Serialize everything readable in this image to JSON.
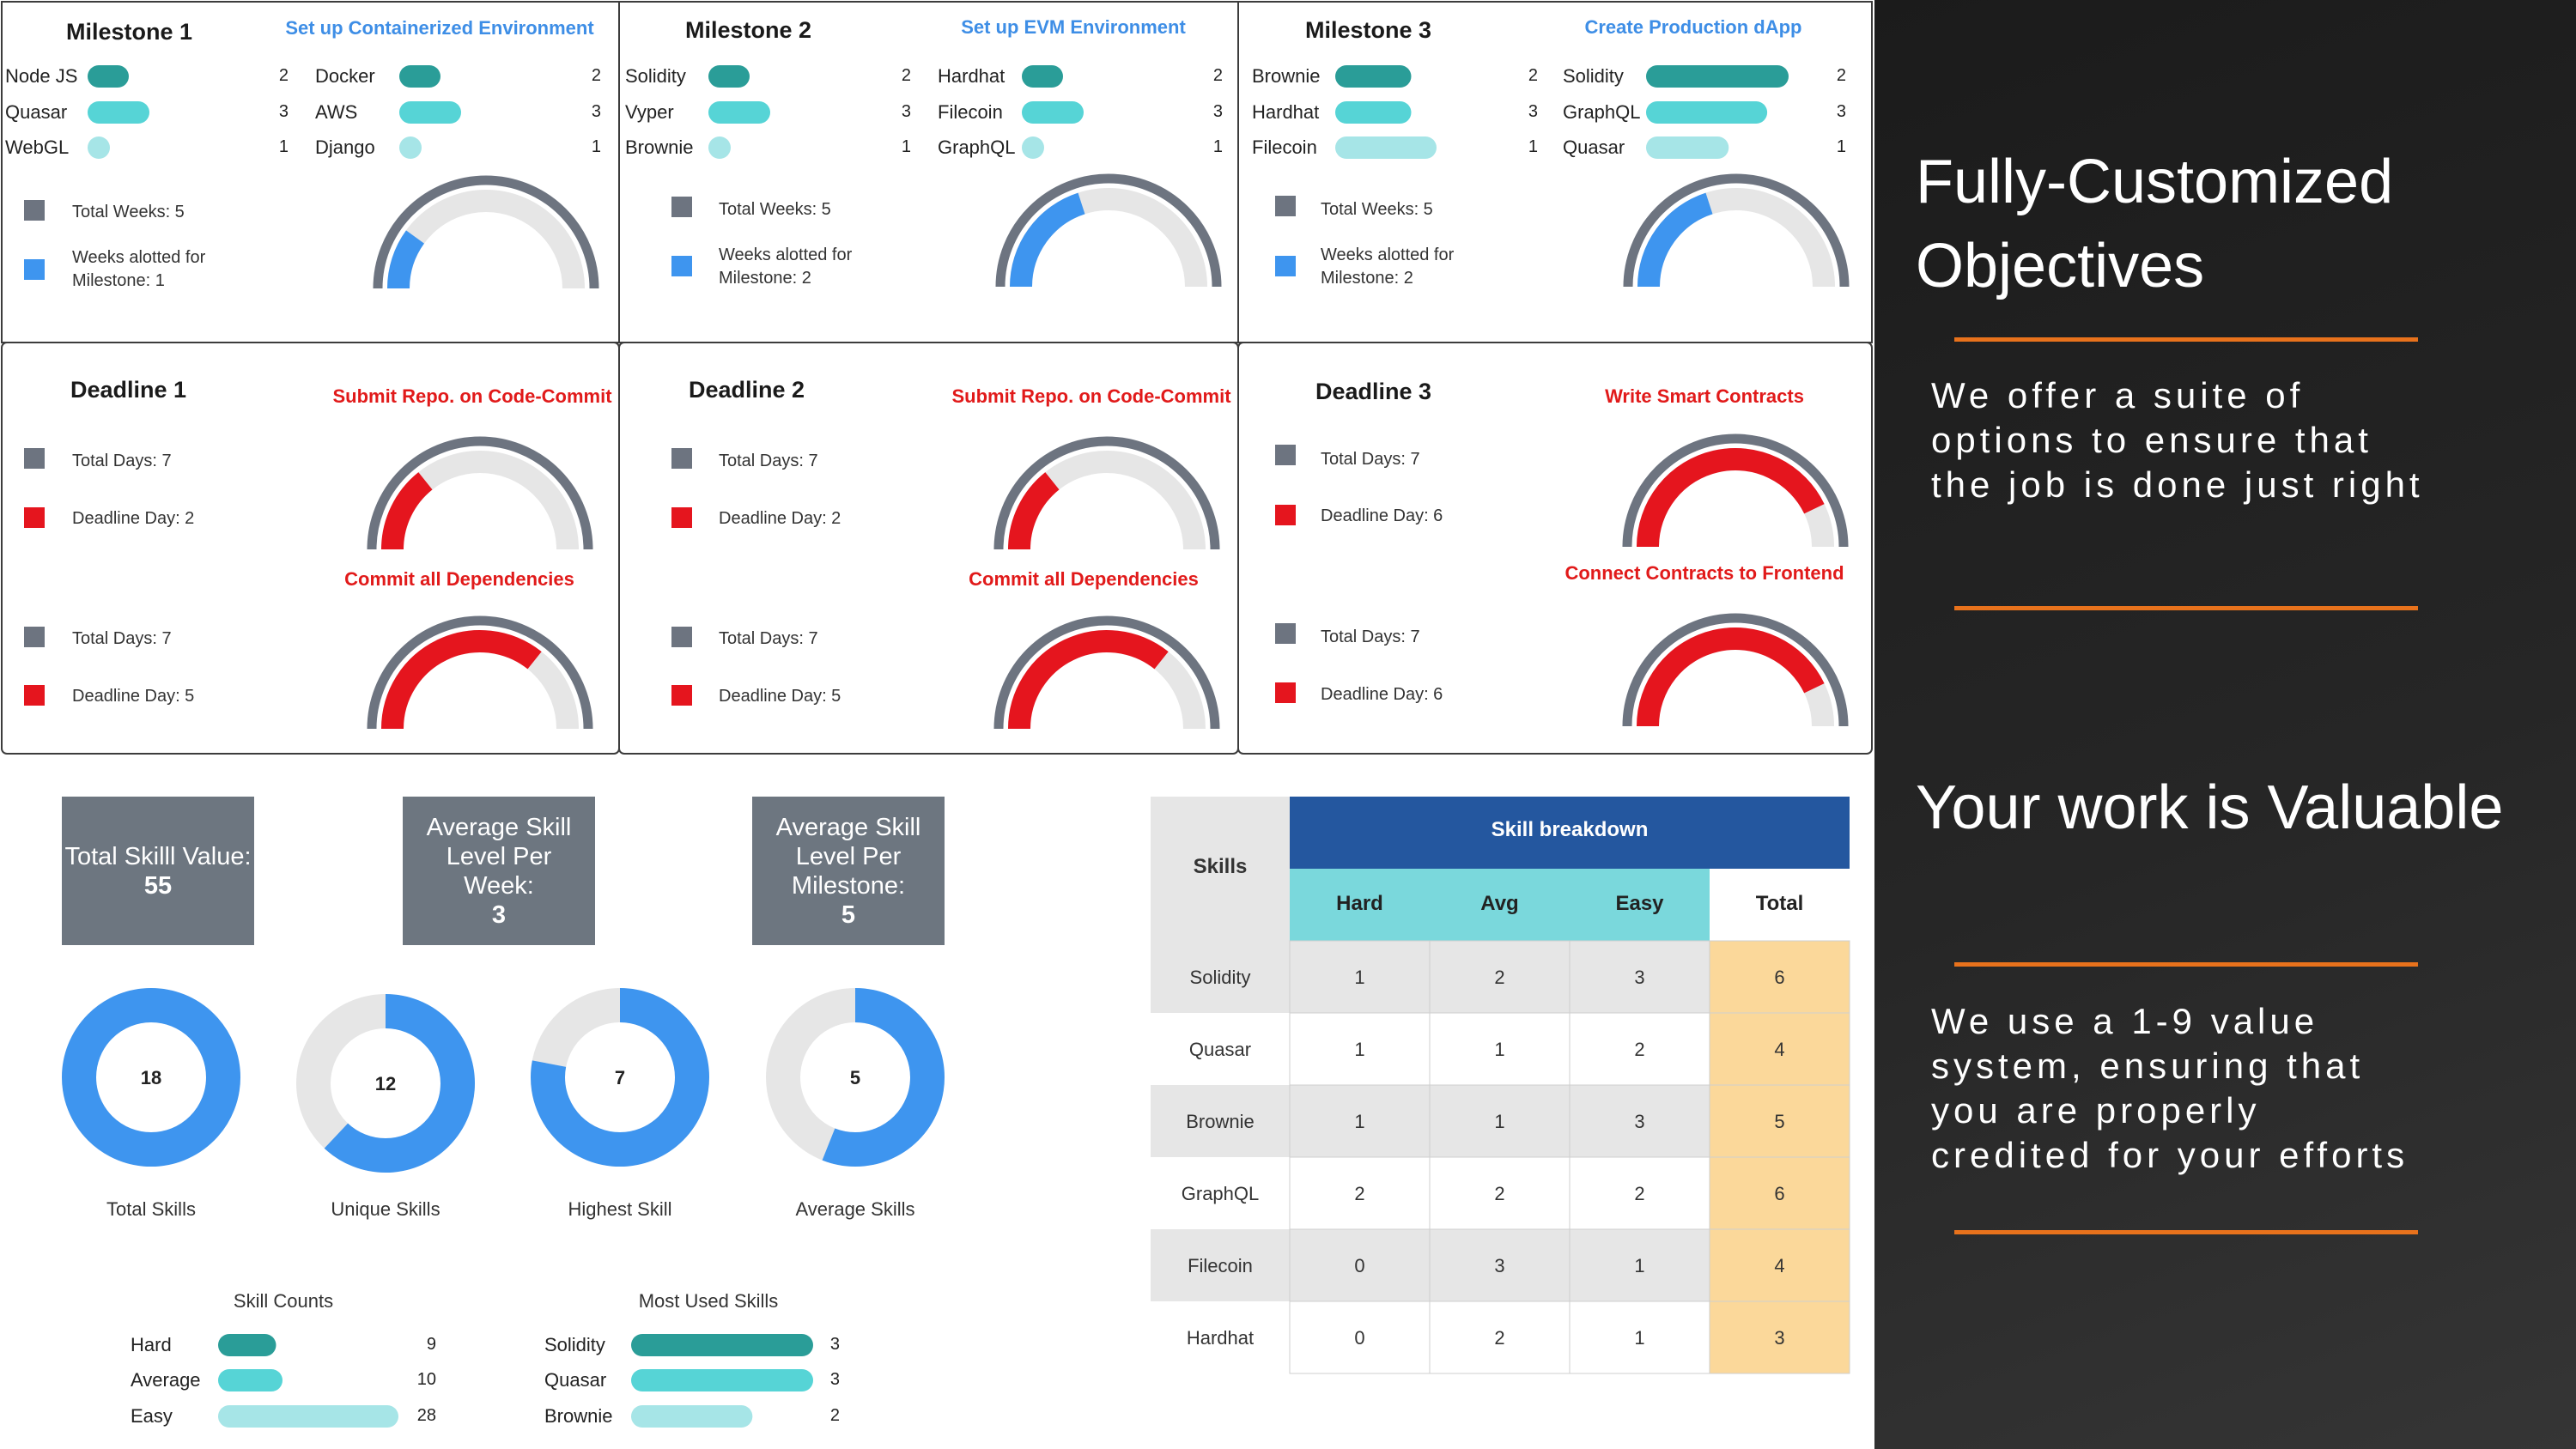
{
  "milestones": [
    {
      "title": "Milestone 1",
      "objective": "Set up Containerized Environment",
      "skills_left": [
        [
          "Node JS",
          2,
          0.45,
          "#2a9d98"
        ],
        [
          "Quasar",
          3,
          0.7,
          "#56d4d6"
        ],
        [
          "WebGL",
          1,
          0.22,
          "#a6e5e7"
        ]
      ],
      "skills_right": [
        [
          "Docker",
          2,
          0.45,
          "#2a9d98"
        ],
        [
          "AWS",
          3,
          0.7,
          "#56d4d6"
        ],
        [
          "Django",
          1,
          0.22,
          "#a6e5e7"
        ]
      ],
      "legend_total": "Total Weeks: 5",
      "legend_weeks": "Weeks alotted for",
      "legend_weeks2": "Milestone: 1",
      "gauge_value": 1,
      "gauge_max": 5
    },
    {
      "title": "Milestone 2",
      "objective": "Set up EVM Environment",
      "skills_left": [
        [
          "Solidity",
          2,
          0.45,
          "#2a9d98"
        ],
        [
          "Vyper",
          3,
          0.7,
          "#56d4d6"
        ],
        [
          "Brownie",
          1,
          0.22,
          "#a6e5e7"
        ]
      ],
      "skills_right": [
        [
          "Hardhat",
          2,
          0.45,
          "#2a9d98"
        ],
        [
          "Filecoin",
          3,
          0.7,
          "#56d4d6"
        ],
        [
          "GraphQL",
          1,
          0.22,
          "#a6e5e7"
        ]
      ],
      "legend_total": "Total Weeks: 5",
      "legend_weeks": "Weeks alotted for",
      "legend_weeks2": "Milestone: 2",
      "gauge_value": 2,
      "gauge_max": 5
    },
    {
      "title": "Milestone 3",
      "objective": "Create Production dApp",
      "skills_left": [
        [
          "Brownie",
          2,
          0.75,
          "#2a9d98"
        ],
        [
          "Hardhat",
          3,
          0.75,
          "#56d4d6"
        ],
        [
          "Filecoin",
          1,
          1.0,
          "#a6e5e7"
        ]
      ],
      "skills_right": [
        [
          "Solidity",
          2,
          1.0,
          "#2a9d98"
        ],
        [
          "GraphQL",
          3,
          0.85,
          "#56d4d6"
        ],
        [
          "Quasar",
          1,
          0.58,
          "#a6e5e7"
        ]
      ],
      "legend_total": "Total Weeks: 5",
      "legend_weeks": "Weeks alotted for",
      "legend_weeks2": "Milestone: 2",
      "gauge_value": 2,
      "gauge_max": 5
    }
  ],
  "deadlines": [
    {
      "title": "Deadline 1",
      "tasks": [
        {
          "label": "Submit Repo. on Code-Commit",
          "total": "Total Days: 7",
          "day": "Deadline Day: 2",
          "value": 2,
          "max": 7
        },
        {
          "label": "Commit all Dependencies",
          "total": "Total Days: 7",
          "day": "Deadline Day: 5",
          "value": 5,
          "max": 7
        }
      ]
    },
    {
      "title": "Deadline 2",
      "tasks": [
        {
          "label": "Submit Repo. on Code-Commit",
          "total": "Total Days: 7",
          "day": "Deadline Day: 2",
          "value": 2,
          "max": 7
        },
        {
          "label": "Commit all Dependencies",
          "total": "Total Days: 7",
          "day": "Deadline Day: 5",
          "value": 5,
          "max": 7
        }
      ]
    },
    {
      "title": "Deadline 3",
      "tasks": [
        {
          "label": "Write Smart Contracts",
          "total": "Total Days: 7",
          "day": "Deadline Day: 6",
          "value": 6,
          "max": 7
        },
        {
          "label": "Connect Contracts to Frontend",
          "total": "Total Days: 7",
          "day": "Deadline Day: 6",
          "value": 6,
          "max": 7
        }
      ]
    }
  ],
  "kpis": [
    {
      "label": "Total Skilll Value:",
      "value": "55"
    },
    {
      "label": "Average Skill Level Per Week:",
      "value": "3"
    },
    {
      "label": "Average Skill Level Per Milestone:",
      "value": "5"
    }
  ],
  "donuts": [
    {
      "value": 18,
      "fraction": 1.0,
      "label": "Total Skills"
    },
    {
      "value": 12,
      "fraction": 0.62,
      "label": "Unique Skills"
    },
    {
      "value": 7,
      "fraction": 0.78,
      "label": "Highest Skill"
    },
    {
      "value": 5,
      "fraction": 0.56,
      "label": "Average Skills"
    }
  ],
  "skill_counts": {
    "title": "Skill Counts",
    "rows": [
      [
        "Hard",
        9,
        "#2a9d98"
      ],
      [
        "Average",
        10,
        "#56d4d6"
      ],
      [
        "Easy",
        28,
        "#a6e5e7"
      ]
    ],
    "max": 28
  },
  "most_used": {
    "title": "Most Used Skills",
    "rows": [
      [
        "Solidity",
        3,
        "#2a9d98"
      ],
      [
        "Quasar",
        3,
        "#56d4d6"
      ],
      [
        "Brownie",
        2,
        "#a6e5e7"
      ]
    ],
    "max": 3
  },
  "table": {
    "corner": "Skills",
    "group_header": "Skill breakdown",
    "columns": [
      "Hard",
      "Avg",
      "Easy",
      "Total"
    ],
    "rows": [
      [
        "Solidity",
        "1",
        "2",
        "3",
        "6"
      ],
      [
        "Quasar",
        "1",
        "1",
        "2",
        "4"
      ],
      [
        "Brownie",
        "1",
        "1",
        "3",
        "5"
      ],
      [
        "GraphQL",
        "2",
        "2",
        "2",
        "6"
      ],
      [
        "Filecoin",
        "0",
        "3",
        "1",
        "4"
      ],
      [
        "Hardhat",
        "0",
        "2",
        "1",
        "3"
      ]
    ]
  },
  "panel": {
    "heading1_line1": "Fully-Customized",
    "heading1_line2": "Objectives",
    "text1": "We offer a suite of options to ensure that the job is done just right",
    "heading2": "Your work is Valuable",
    "text2": "We use a 1-9 value system, ensuring that you are properly credited for your efforts"
  },
  "colors": {
    "gauge_track": "#e6e6e6",
    "gauge_frame": "#6d7480",
    "gauge_blue": "#3e95ef",
    "gauge_red": "#e5151e",
    "objective_blue": "#3e8ee6",
    "deadline_red": "#e11a1a",
    "table_header": "#24579f",
    "table_sub": "#7ad8dc",
    "table_total": "#fbd89a"
  }
}
